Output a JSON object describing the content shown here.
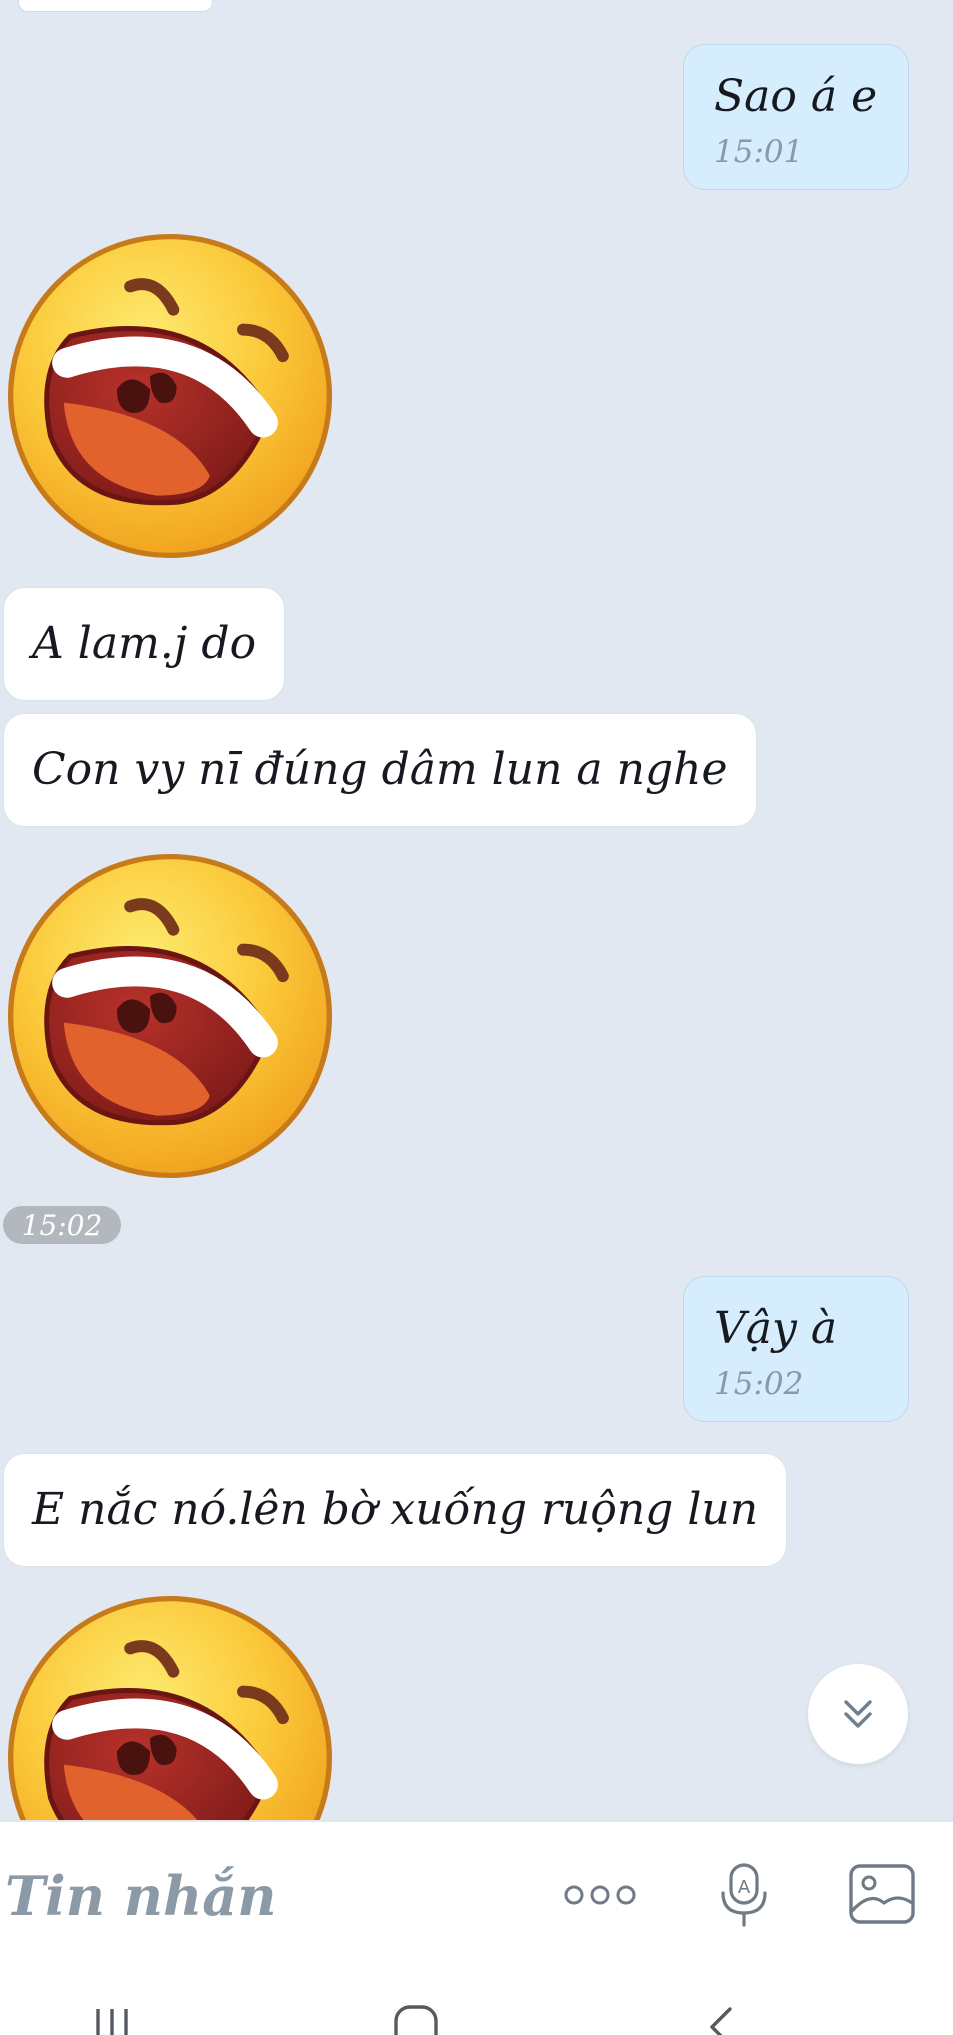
{
  "messages": [
    {
      "type": "out",
      "text": "Sao á e",
      "time": "15:01"
    },
    {
      "type": "sticker",
      "name": "laughing-face-sticker"
    },
    {
      "type": "in",
      "text": "A lam.j do"
    },
    {
      "type": "in",
      "text": "Con vy nī đúng dâm lun a nghe"
    },
    {
      "type": "sticker",
      "name": "laughing-face-sticker"
    },
    {
      "type": "out",
      "text": "Vậy à",
      "time": "15:02"
    },
    {
      "type": "in",
      "text": "E nắc nó.lên bờ xuống ruộng lun"
    },
    {
      "type": "sticker",
      "name": "laughing-face-sticker"
    }
  ],
  "group_time": "15:02",
  "input": {
    "placeholder": "Tin nhắn"
  },
  "icons": {
    "scroll_down": "double-chevron-down-icon",
    "more": "more-dots-icon",
    "mic": "microphone-icon",
    "image": "image-icon",
    "nav_recent": "recent-apps-icon",
    "nav_home": "home-icon",
    "nav_back": "back-icon"
  },
  "colors": {
    "chat_bg": "#e2e8f1",
    "incoming_bubble": "#ffffff",
    "outgoing_bubble": "#d5edfc",
    "placeholder": "#8c99a6",
    "timestamp_pill": "#b3b8bf"
  }
}
